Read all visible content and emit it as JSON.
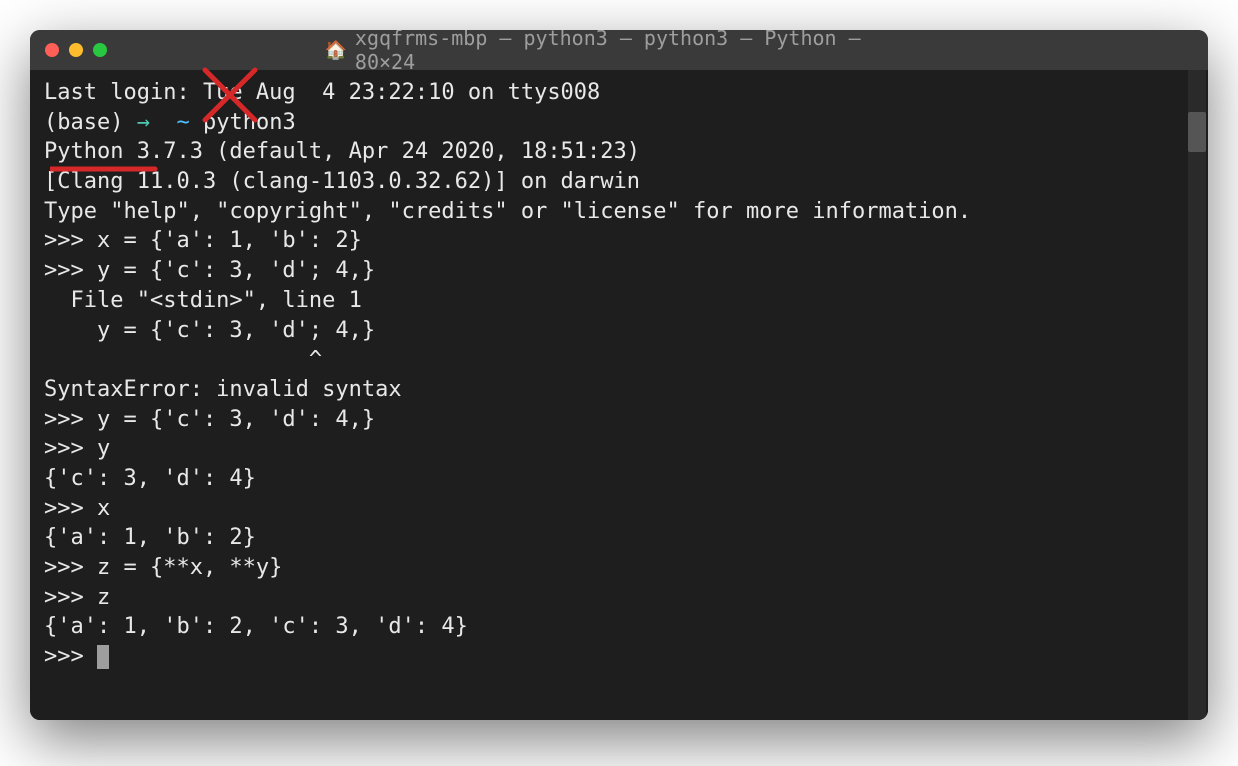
{
  "window": {
    "title": "xgqfrms-mbp — python3 — python3 — Python — 80×24"
  },
  "terminal": {
    "lines": [
      "Last login: Tue Aug  4 23:22:10 on ttys008",
      "",
      "Python 3.7.3 (default, Apr 24 2020, 18:51:23)",
      "[Clang 11.0.3 (clang-1103.0.32.62)] on darwin",
      "Type \"help\", \"copyright\", \"credits\" or \"license\" for more information.",
      ">>> x = {'a': 1, 'b': 2}",
      ">>> y = {'c': 3, 'd'; 4,}",
      "  File \"<stdin>\", line 1",
      "    y = {'c': 3, 'd'; 4,}",
      "                    ^",
      "SyntaxError: invalid syntax",
      ">>> y = {'c': 3, 'd': 4,}",
      ">>> y",
      "{'c': 3, 'd': 4}",
      ">>> x",
      "{'a': 1, 'b': 2}",
      ">>> z = {**x, **y}",
      ">>> z",
      "{'a': 1, 'b': 2, 'c': 3, 'd': 4}",
      ">>> "
    ],
    "prompt": {
      "base": "(base)",
      "arrow": "→",
      "tilde": "~",
      "command": "python3"
    }
  }
}
